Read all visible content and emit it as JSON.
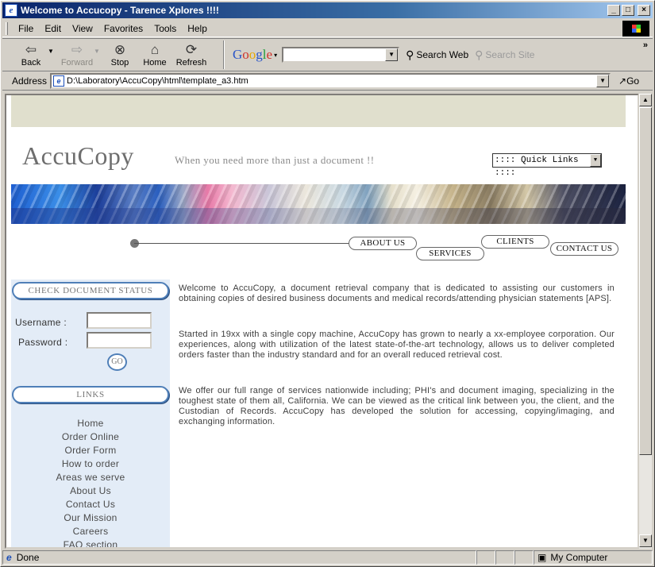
{
  "window": {
    "title": "Welcome to Accucopy - Tarence Xplores !!!!",
    "controls": {
      "minimize": "_",
      "maximize": "□",
      "close": "×"
    }
  },
  "menu": [
    "File",
    "Edit",
    "View",
    "Favorites",
    "Tools",
    "Help"
  ],
  "toolbar": {
    "back": "Back",
    "forward": "Forward",
    "stop": "Stop",
    "home": "Home",
    "refresh": "Refresh",
    "google_search_web": "Search Web",
    "google_search_site": "Search Site",
    "search_value": ""
  },
  "address": {
    "label": "Address",
    "value": "D:\\Laboratory\\AccuCopy\\html\\template_a3.htm",
    "go": "Go"
  },
  "page": {
    "logo": "AccuCopy",
    "tagline": "When you need more than just a document !!",
    "quick_links": ":::: Quick Links ::::",
    "nav": {
      "about": "ABOUT US",
      "services": "SERVICES",
      "clients": "CLIENTS",
      "contact": "CONTACT US"
    },
    "check_status": {
      "heading": "CHECK DOCUMENT STATUS",
      "username_label": "Username :",
      "password_label": "Password :",
      "go": "GO"
    },
    "links": {
      "heading": "LINKS",
      "items": [
        "Home",
        "Order Online",
        "Order Form",
        "How to order",
        "Areas we serve",
        "About Us",
        "Contact Us",
        "Our Mission",
        "Careers",
        "FAQ section"
      ]
    },
    "paragraphs": [
      "Welcome to AccuCopy, a document retrieval company that is dedicated to assisting our customers in obtaining copies of desired business documents and medical records/attending physician statements [APS].",
      "Started in 19xx with a single copy machine, AccuCopy has grown to nearly a xx-employee corporation. Our experiences, along with utilization of the latest state-of-the-art technology, allows us to deliver completed orders faster than the industry standard and for an overall reduced retrieval cost.",
      "We offer our full range of services nationwide including; PHI's and document imaging, specializing in the toughest state of them all, California. We can be viewed as the critical link between you, the client, and the Custodian of Records. AccuCopy has developed the solution for accessing, copying/imaging, and exchanging information."
    ]
  },
  "status": {
    "text": "Done",
    "zone": "My Computer"
  }
}
